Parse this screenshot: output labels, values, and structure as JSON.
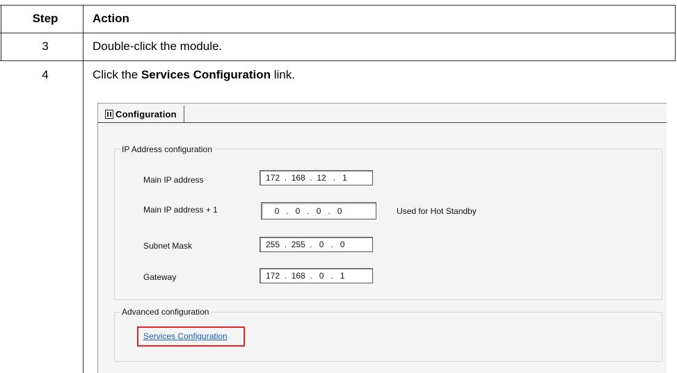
{
  "table": {
    "header": {
      "step": "Step",
      "action": "Action"
    },
    "rows": [
      {
        "step": "3",
        "action": "Double-click the module."
      },
      {
        "step": "4",
        "action_prefix": "Click the ",
        "action_bold": "Services Configuration",
        "action_suffix": " link."
      }
    ]
  },
  "screenshot": {
    "tab_label": "Configuration",
    "ip_group_title": "IP  Address configuration",
    "fields": [
      {
        "label": "Main IP address",
        "value": "172  .  168  .  12   .   1"
      },
      {
        "label": "Main IP address + 1",
        "value": "  0   .   0   .   0   .   0",
        "note": "Used for Hot Standby"
      },
      {
        "label": "Subnet Mask",
        "value": "255  .  255  .   0   .   0"
      },
      {
        "label": "Gateway",
        "value": "172  .  168  .   0   .   1"
      }
    ],
    "advanced_group_title": "Advanced configuration",
    "services_link": "Services Configuration"
  },
  "colors": {
    "highlight": "#e3242b",
    "link": "#1a5fb4"
  }
}
